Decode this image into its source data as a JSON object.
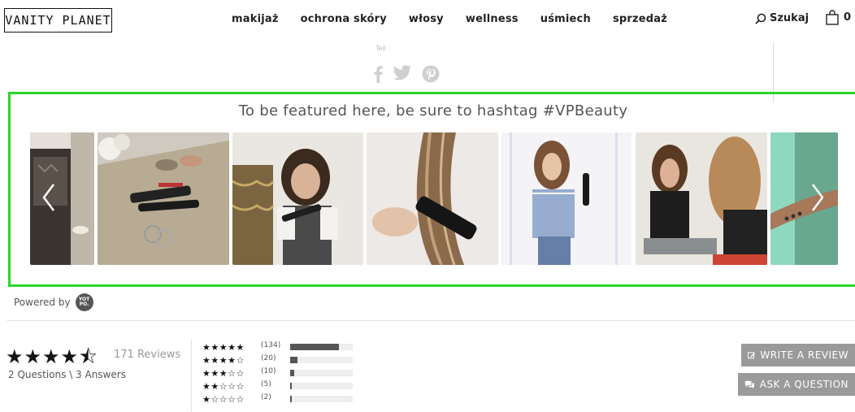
{
  "header": {
    "logo": "VANITY PLANET",
    "nav": [
      "makijaż",
      "ochrona skóry",
      "włosy",
      "wellness",
      "uśmiech",
      "sprzedaż"
    ],
    "search_label": "Szukaj",
    "cart_count": "0"
  },
  "share": {
    "label": "Tell",
    "icons": [
      "facebook-icon",
      "twitter-icon",
      "pinterest-icon"
    ]
  },
  "featured": {
    "title": "To be featured here, be sure to hashtag #VPBeauty",
    "border_color": "#2ad62a"
  },
  "powered": {
    "label": "Powered by",
    "badge": "YOT PO."
  },
  "reviews": {
    "stars": "★★★★⯪",
    "review_count": "171 Reviews",
    "qa": "2 Questions \\ 3 Answers",
    "distribution": [
      {
        "stars": "★★★★★",
        "count": "(134)",
        "fraction": 0.78
      },
      {
        "stars": "★★★★☆",
        "count": "(20)",
        "fraction": 0.12
      },
      {
        "stars": "★★★☆☆",
        "count": "(10)",
        "fraction": 0.06
      },
      {
        "stars": "★★☆☆☆",
        "count": "(5)",
        "fraction": 0.03
      },
      {
        "stars": "★☆☆☆☆",
        "count": "(2)",
        "fraction": 0.015
      }
    ],
    "write_review": "WRITE A REVIEW",
    "ask_question": "ASK A QUESTION"
  }
}
